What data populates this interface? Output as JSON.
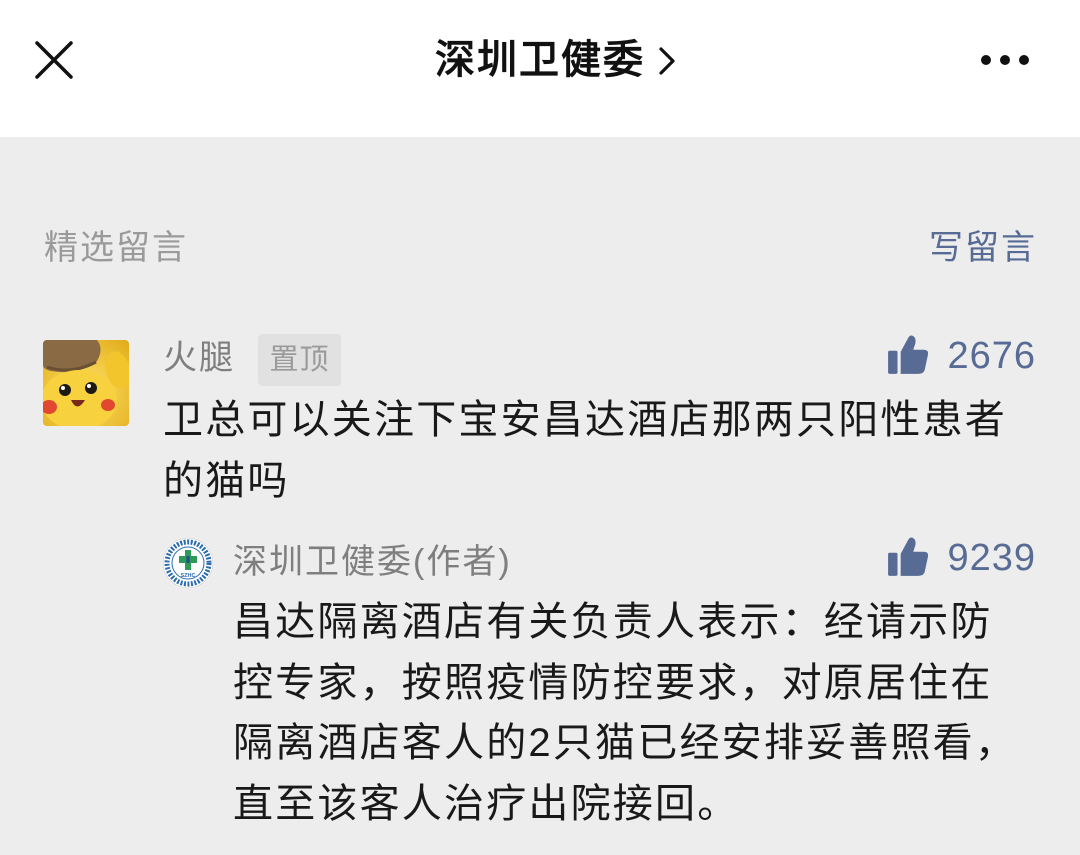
{
  "topbar": {
    "title": "深圳卫健委",
    "icons": {
      "close": "close-icon",
      "chevron": "chevron-right-icon",
      "more": "more-icon"
    }
  },
  "comments_section": {
    "heading": "精选留言",
    "write_comment_label": "写留言"
  },
  "comments": [
    {
      "avatar_icon": "pikachu-avatar",
      "author": "火腿",
      "badge": "置顶",
      "like_icon": "thumbs-up-icon",
      "likes": "2676",
      "text": "卫总可以关注下宝安昌达酒店那两只阳性患者的猫吗",
      "reply": {
        "avatar_icon": "szhc-logo-avatar",
        "avatar_logo_text": "SZHC",
        "author": "深圳卫健委(作者)",
        "like_icon": "thumbs-up-icon",
        "likes": "9239",
        "text": "昌达隔离酒店有关负责人表示：经请示防控专家，按照疫情防控要求，对原居住在隔离酒店客人的2只猫已经安排妥善照看，直至该客人治疗出院接回。"
      }
    }
  ],
  "colors": {
    "accent": "#576b95",
    "background": "#ededed",
    "topbar": "#ffffff",
    "text": "#191919",
    "meta": "#7f7f7f"
  }
}
